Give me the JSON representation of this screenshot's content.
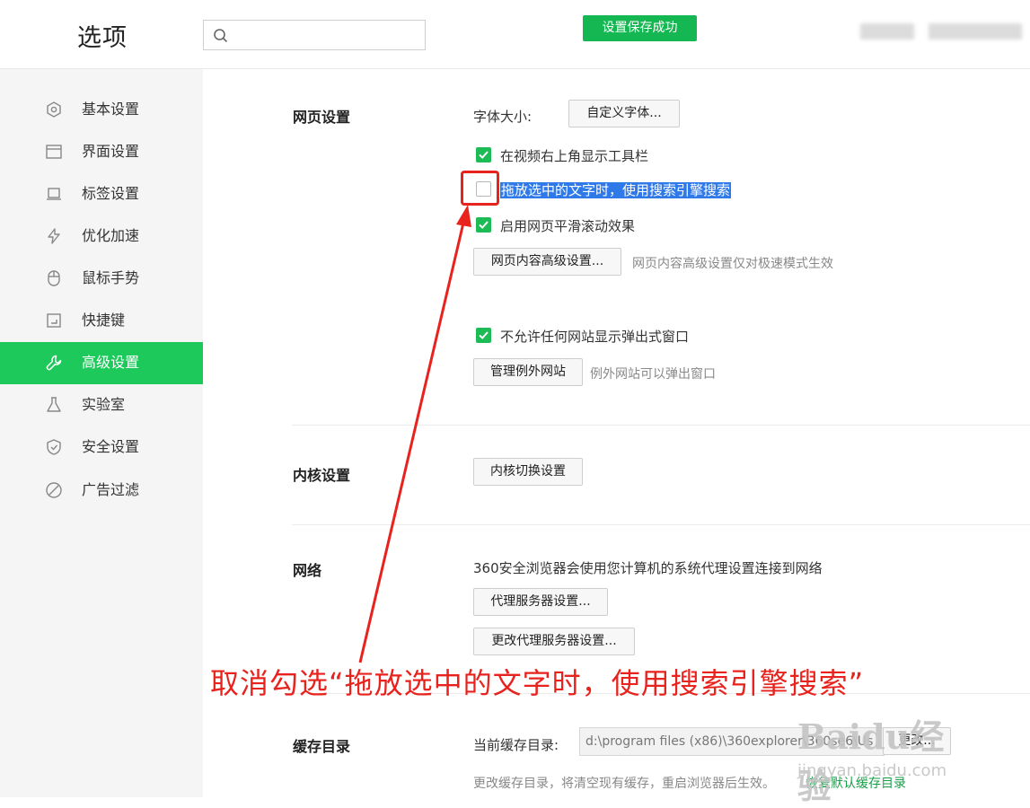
{
  "header": {
    "title": "选项",
    "search_placeholder": "",
    "toast": "设置保存成功"
  },
  "sidebar": {
    "items": [
      {
        "label": "基本设置",
        "icon": "hexagon-settings-icon"
      },
      {
        "label": "界面设置",
        "icon": "window-icon"
      },
      {
        "label": "标签设置",
        "icon": "laptop-icon"
      },
      {
        "label": "优化加速",
        "icon": "lightning-icon"
      },
      {
        "label": "鼠标手势",
        "icon": "mouse-icon"
      },
      {
        "label": "快捷键",
        "icon": "shortcut-icon"
      },
      {
        "label": "高级设置",
        "icon": "wrench-icon",
        "active": true
      },
      {
        "label": "实验室",
        "icon": "flask-icon"
      },
      {
        "label": "安全设置",
        "icon": "shield-icon"
      },
      {
        "label": "广告过滤",
        "icon": "block-icon"
      }
    ]
  },
  "web_settings": {
    "title": "网页设置",
    "font_size_label": "字体大小:",
    "custom_font_button": "自定义字体...",
    "opt_toolbar": {
      "label": "在视频右上角显示工具栏",
      "checked": true
    },
    "opt_drag_search": {
      "label": "拖放选中的文字时，使用搜索引擎搜索",
      "checked": false
    },
    "opt_smooth_scroll": {
      "label": "启用网页平滑滚动效果",
      "checked": true
    },
    "advanced_button": "网页内容高级设置...",
    "advanced_hint": "网页内容高级设置仅对极速模式生效",
    "opt_no_popup": {
      "label": "不允许任何网站显示弹出式窗口",
      "checked": true
    },
    "exceptions_button": "管理例外网站",
    "exceptions_hint": "例外网站可以弹出窗口"
  },
  "kernel_settings": {
    "title": "内核设置",
    "switch_button": "内核切换设置"
  },
  "network": {
    "title": "网络",
    "description": "360安全浏览器会使用您计算机的系统代理设置连接到网络",
    "proxy_button": "代理服务器设置...",
    "change_proxy_button": "更改代理服务器设置..."
  },
  "cache": {
    "title": "缓存目录",
    "current_label": "当前缓存目录:",
    "path_value": "d:\\program files (x86)\\360explorer\\360se6\\Us",
    "change_button": "更改...",
    "hint": "更改缓存目录，将清空现有缓存，重启浏览器后生效。",
    "restore_link": "恢复默认缓存目录"
  },
  "annotation": {
    "text": "取消勾选“拖放选中的文字时，使用搜索引擎搜索”"
  },
  "watermark": {
    "brand": "Baidu经验",
    "sub": "jingyan.baidu.com"
  },
  "colors": {
    "accent": "#1dc95a",
    "checkbox": "#1dbb55",
    "annotation": "#e8231e",
    "selection": "#2f7ae8"
  }
}
